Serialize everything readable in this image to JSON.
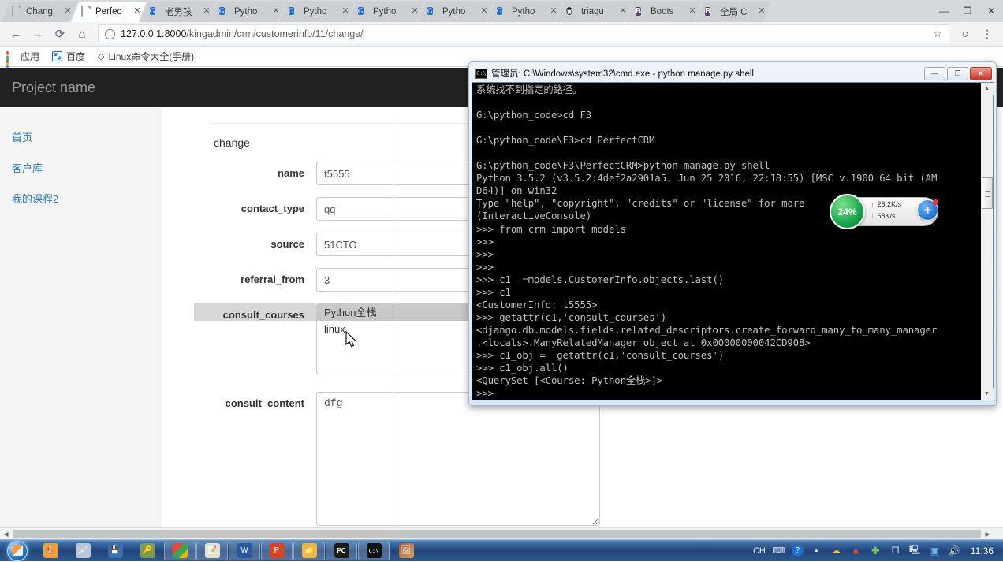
{
  "browser": {
    "tabs": [
      {
        "label": "Chang",
        "favicon": "document-icon",
        "active": false
      },
      {
        "label": "Perfec",
        "favicon": "document-icon",
        "active": true
      },
      {
        "label": "老男孩",
        "favicon": "blue-globe-icon",
        "active": false
      },
      {
        "label": "Pytho",
        "favicon": "blue-globe-icon",
        "active": false
      },
      {
        "label": "Pytho",
        "favicon": "blue-globe-icon",
        "active": false
      },
      {
        "label": "Pytho",
        "favicon": "blue-globe-icon",
        "active": false
      },
      {
        "label": "Pytho",
        "favicon": "blue-globe-icon",
        "active": false
      },
      {
        "label": "Pytho",
        "favicon": "blue-globe-icon",
        "active": false
      },
      {
        "label": "triaqu",
        "favicon": "github-icon",
        "active": false
      },
      {
        "label": "Boots",
        "favicon": "bootstrap-icon",
        "active": false
      },
      {
        "label": "全局 C",
        "favicon": "bootstrap-icon",
        "active": false
      }
    ],
    "tab_close_label": "✕",
    "window_controls": {
      "profile": "person-icon",
      "minimize": "—",
      "maximize": "❐",
      "close": "✕"
    },
    "nav": {
      "back": "←",
      "forward": "→",
      "reload": "⟳",
      "home": "⌂"
    },
    "omnibox": {
      "info_icon": "i",
      "url_host": "127.0.0.1:8000",
      "url_path": "/kingadmin/crm/customerinfo/11/change/",
      "star_icon": "☆"
    },
    "extension_icon": "○",
    "menu_icon": "⋮",
    "bookmarks": [
      {
        "label": "应用",
        "icon": "apps-grid-icon"
      },
      {
        "label": "百度",
        "icon": "baidu-icon"
      },
      {
        "label": "Linux命令大全(手册)",
        "icon": "diamond-icon"
      }
    ]
  },
  "webpage": {
    "brand": "Project name",
    "sidebar": [
      {
        "label": "首页"
      },
      {
        "label": "客户库"
      },
      {
        "label": "我的课程2"
      }
    ],
    "form": {
      "title": "change",
      "fields": [
        {
          "label": "name",
          "value": "t5555",
          "type": "text"
        },
        {
          "label": "contact_type",
          "value": "qq",
          "type": "text"
        },
        {
          "label": "source",
          "value": "51CTO",
          "type": "text"
        },
        {
          "label": "referral_from",
          "value": "3",
          "type": "text"
        }
      ],
      "multiselect": {
        "label": "consult_courses",
        "options": [
          {
            "label": "Python全栈",
            "selected": true
          },
          {
            "label": "linux",
            "selected": false
          }
        ]
      },
      "textarea": {
        "label": "consult_content",
        "value": "dfg"
      }
    },
    "hscroll": {
      "left_arrow": "◀",
      "right_arrow": "▶"
    }
  },
  "cmd": {
    "title": "管理员: C:\\Windows\\system32\\cmd.exe - python  manage.py shell",
    "icon_label": "C:\\",
    "controls": {
      "minimize": "—",
      "maximize": "❐",
      "close": "✕"
    },
    "scroll": {
      "up": "▲",
      "down": "▼"
    },
    "output": "系统找不到指定的路径。\n\nG:\\python_code>cd F3\n\nG:\\python_code\\F3>cd PerfectCRM\n\nG:\\python_code\\F3\\PerfectCRM>python manage.py shell\nPython 3.5.2 (v3.5.2:4def2a2901a5, Jun 25 2016, 22:18:55) [MSC v.1900 64 bit (AM\nD64)] on win32\nType \"help\", \"copyright\", \"credits\" or \"license\" for more\n(InteractiveConsole)\n>>> from crm import models\n>>>\n>>>\n>>>\n>>> c1  =models.CustomerInfo.objects.last()\n>>> c1\n<CustomerInfo: t5555>\n>>> getattr(c1,'consult_courses')\n<django.db.models.fields.related_descriptors.create_forward_many_to_many_manager\n.<locals>.ManyRelatedManager object at 0x00000000042CD908>\n>>> c1_obj =  getattr(c1,'consult_courses')\n>>> c1_obj.all()\n<QuerySet [<Course: Python全栈>]>\n>>>"
  },
  "network_widget": {
    "percent": "24%",
    "upload": "28.2K/s",
    "download": "68K/s",
    "up_arrow": "↑",
    "down_arrow": "↓",
    "plus": "+"
  },
  "taskbar": {
    "start": "windows-orb-icon",
    "items": [
      {
        "name": "paint-icon",
        "glyph": "🎨",
        "color": "#e8a33d",
        "framed": false
      },
      {
        "name": "paint-brush-icon",
        "glyph": "🖌",
        "color": "#b8c6d8",
        "framed": false
      },
      {
        "name": "save-disk-icon",
        "glyph": "💾",
        "color": "#3b6fb5",
        "framed": false
      },
      {
        "name": "key-icon",
        "glyph": "🔑",
        "color": "#7f9a57",
        "framed": false
      },
      {
        "name": "chrome-icon",
        "glyph": "◉",
        "color": "#e8453c",
        "framed": true
      },
      {
        "name": "notepad-icon",
        "glyph": "📝",
        "color": "#d8d8c8",
        "framed": true
      },
      {
        "name": "word-icon",
        "glyph": "W",
        "color": "#2b579a",
        "framed": true
      },
      {
        "name": "powerpoint-icon",
        "glyph": "P",
        "color": "#d24726",
        "framed": true
      },
      {
        "name": "folder-icon",
        "glyph": "📁",
        "color": "#e8b84b",
        "framed": true
      },
      {
        "name": "pycharm-icon",
        "glyph": "PC",
        "color": "#1a1a1a",
        "framed": true
      },
      {
        "name": "cmd-icon",
        "glyph": "C:\\",
        "color": "#111111",
        "framed": true
      },
      {
        "name": "photo-icon",
        "glyph": "🖼",
        "color": "#8a5a3b",
        "framed": false
      }
    ],
    "tray": {
      "ime": "CH",
      "keyboard": "⌨",
      "help": "?",
      "overflow": "▲",
      "icons": [
        "cloud-sync-icon",
        "red-circle-icon",
        "green-shield-icon",
        "copy-icon",
        "monitor-icon",
        "blue-app-icon",
        "volume-icon"
      ],
      "clock": "11:36"
    }
  }
}
